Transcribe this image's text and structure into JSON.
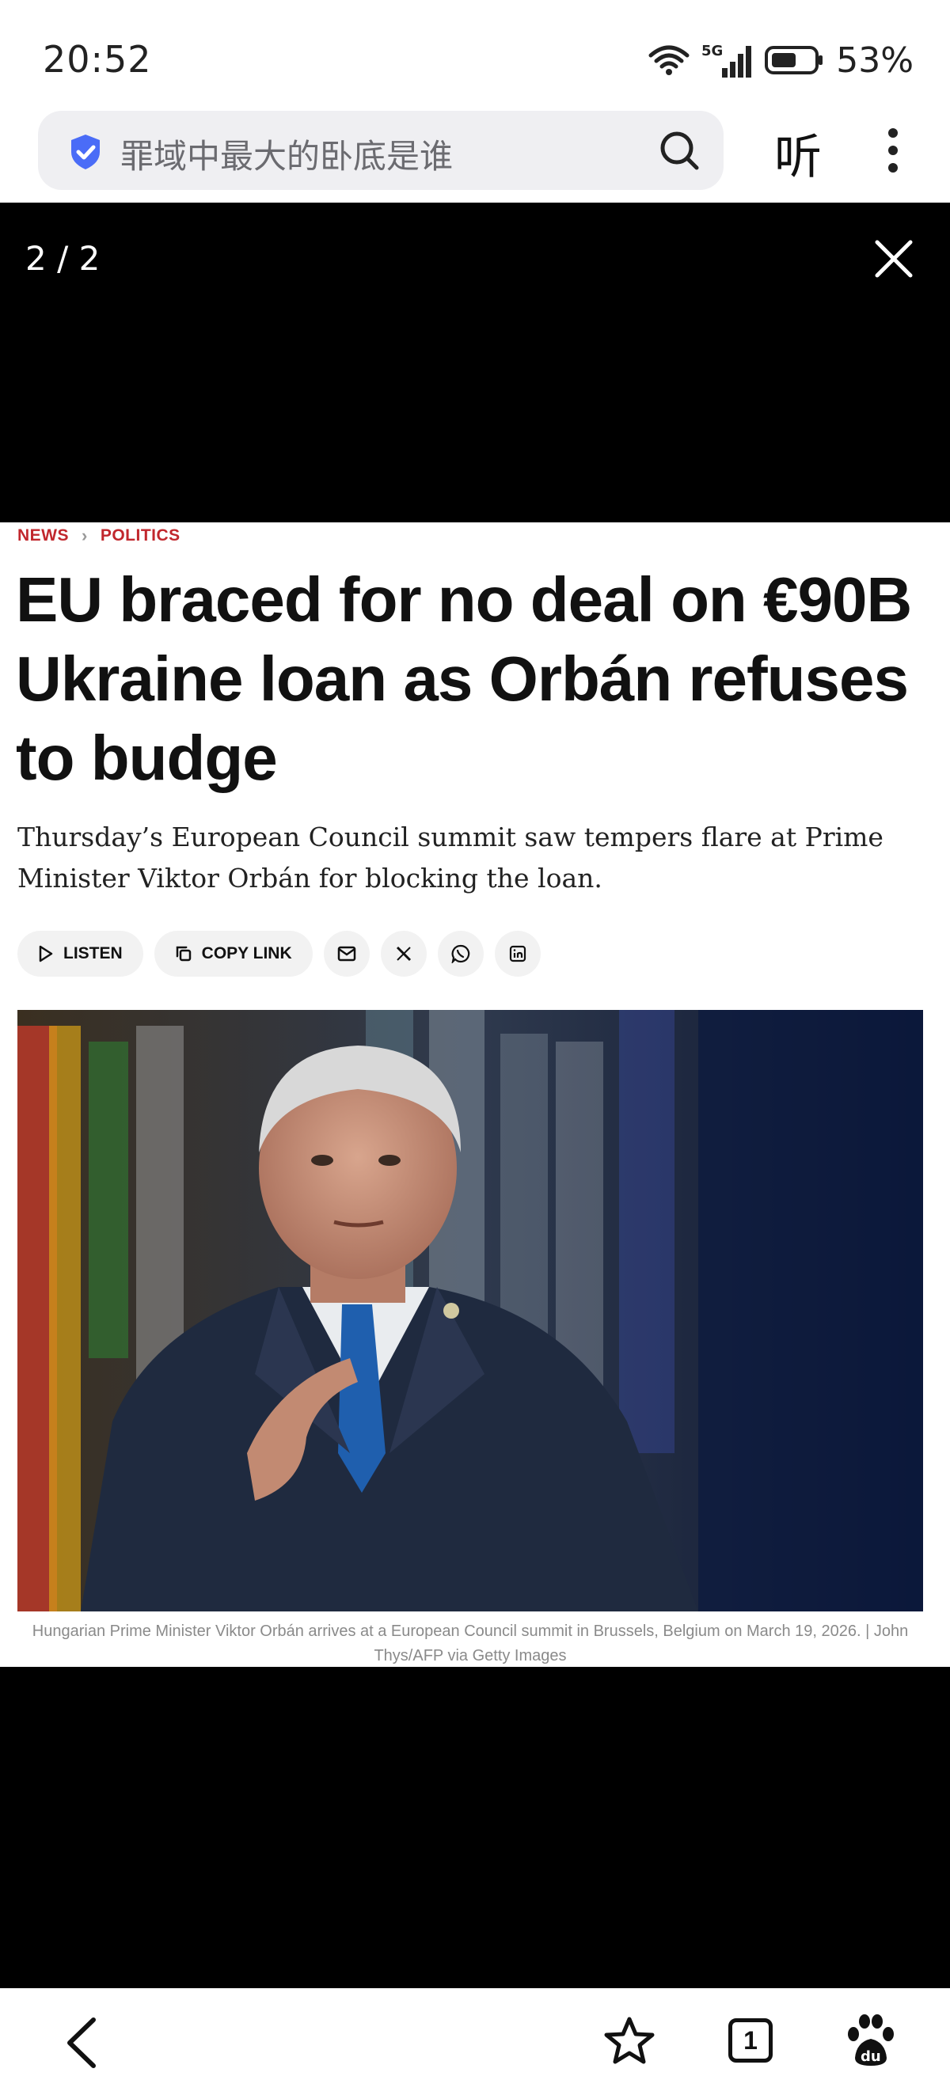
{
  "status_bar": {
    "time": "20:52",
    "network": "5G",
    "battery": "53%"
  },
  "search": {
    "query": "罪域中最大的卧底是谁",
    "listen_label": "听"
  },
  "viewer": {
    "counter": "2 / 2"
  },
  "article": {
    "breadcrumb": [
      "NEWS",
      "POLITICS"
    ],
    "headline": "EU braced for no deal on €90B Ukraine loan as Orbán refuses to budge",
    "dek": "Thursday’s European Council summit saw tempers flare at Prime Minister Viktor Orbán for blocking the loan.",
    "share": {
      "listen_label": "LISTEN",
      "copy_link_label": "COPY LINK"
    },
    "caption": "Hungarian Prime Minister Viktor Orbán arrives at a European Council summit in Brussels, Belgium on March 19, 2026. | John Thys/AFP via Getty Images"
  },
  "bottom_nav": {
    "tab_count": "1"
  },
  "colors": {
    "accent_red": "#c1272d",
    "shield_blue": "#4a6cf7",
    "viewer_black": "#000000"
  },
  "icons": [
    "wifi-icon",
    "signal-icon",
    "battery-icon",
    "shield-icon",
    "search-icon",
    "more-icon",
    "close-icon",
    "play-icon",
    "copy-icon",
    "email-icon",
    "x-icon",
    "whatsapp-icon",
    "linkedin-icon",
    "back-icon",
    "star-icon",
    "tabs-icon",
    "baidu-paw-icon"
  ]
}
